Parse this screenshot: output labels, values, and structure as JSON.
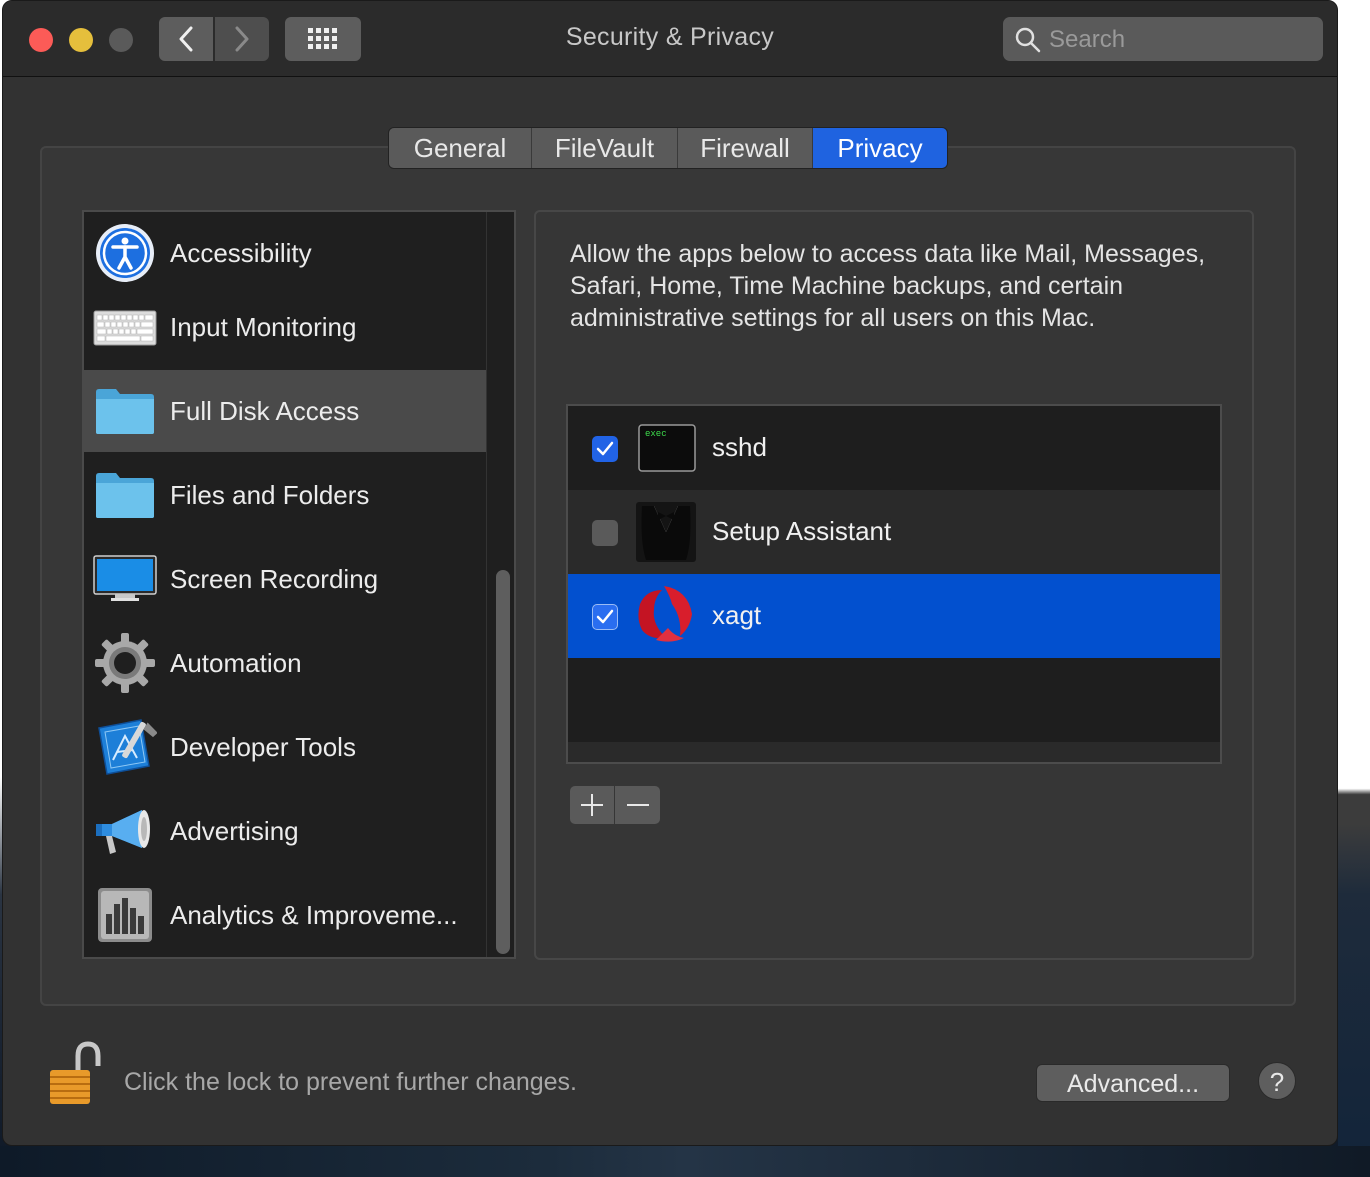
{
  "window": {
    "title": "Security & Privacy"
  },
  "search": {
    "placeholder": "Search",
    "icon": "search-icon"
  },
  "nav": {
    "back_icon": "chevron-left-icon",
    "forward_icon": "chevron-right-icon",
    "grid_icon": "grid-icon"
  },
  "tabs": [
    {
      "label": "General",
      "active": false
    },
    {
      "label": "FileVault",
      "active": false
    },
    {
      "label": "Firewall",
      "active": false
    },
    {
      "label": "Privacy",
      "active": true
    }
  ],
  "sidebar": {
    "items": [
      {
        "label": "Accessibility",
        "icon": "accessibility-icon"
      },
      {
        "label": "Input Monitoring",
        "icon": "keyboard-icon"
      },
      {
        "label": "Full Disk Access",
        "icon": "folder-icon",
        "selected": true
      },
      {
        "label": "Files and Folders",
        "icon": "folder-icon"
      },
      {
        "label": "Screen Recording",
        "icon": "display-icon"
      },
      {
        "label": "Automation",
        "icon": "gear-icon"
      },
      {
        "label": "Developer Tools",
        "icon": "xcode-icon"
      },
      {
        "label": "Advertising",
        "icon": "megaphone-icon"
      },
      {
        "label": "Analytics & Improveme...",
        "icon": "analytics-icon"
      }
    ]
  },
  "detail": {
    "description": "Allow the apps below to access data like Mail, Messages, Safari, Home, Time Machine backups, and certain administrative settings for all users on this Mac.",
    "apps": [
      {
        "name": "sshd",
        "checked": true,
        "icon": "terminal-exec-icon",
        "icon_text": "exec"
      },
      {
        "name": "Setup Assistant",
        "checked": false,
        "icon": "tuxedo-icon"
      },
      {
        "name": "xagt",
        "checked": true,
        "icon": "fireeye-icon",
        "selected": true
      }
    ],
    "add_label": "+",
    "remove_label": "−"
  },
  "footer": {
    "lock_text": "Click the lock to prevent further changes.",
    "advanced_label": "Advanced...",
    "help_label": "?"
  },
  "colors": {
    "accent": "#1f63e0",
    "selection": "#0250cf",
    "window_bg": "#323232"
  }
}
